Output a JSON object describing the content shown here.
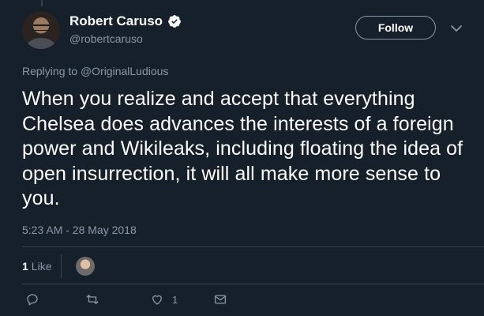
{
  "user": {
    "display_name": "Robert Caruso",
    "handle": "@robertcaruso",
    "verified": true
  },
  "follow_button": {
    "label": "Follow"
  },
  "reply": {
    "prefix": "Replying to ",
    "mention": "@OriginalLudious"
  },
  "tweet": {
    "text": "When you realize and accept that everything Chelsea does advances the interests of a foreign power and Wikileaks, including floating the idea of open insurrection, it will all make more sense to you.",
    "timestamp": "5:23 AM - 28 May 2018"
  },
  "likes": {
    "count": "1",
    "label": "Like"
  },
  "actions": {
    "reply_icon": "reply-icon",
    "retweet_icon": "retweet-icon",
    "like_icon": "heart-icon",
    "like_count": "1",
    "dm_icon": "envelope-icon"
  },
  "colors": {
    "background": "#15202b",
    "secondary_text": "#8899a6",
    "divider": "#38444d",
    "verified_blue": "#ffffff"
  }
}
